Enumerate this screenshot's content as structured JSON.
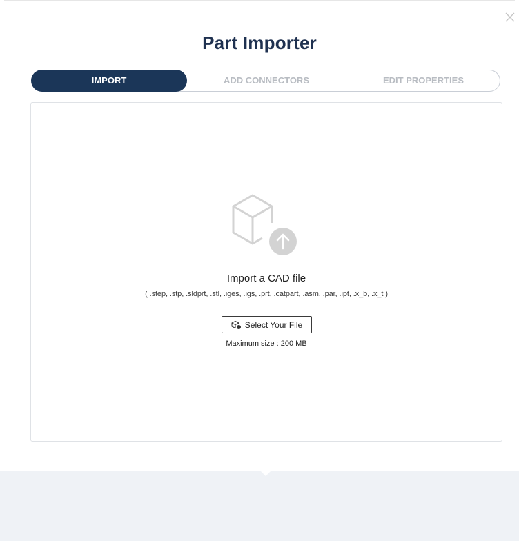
{
  "dialog": {
    "title": "Part Importer",
    "close_icon": "close-icon"
  },
  "steps": [
    {
      "label": "IMPORT",
      "active": true
    },
    {
      "label": "ADD CONNECTORS",
      "active": false
    },
    {
      "label": "EDIT PROPERTIES",
      "active": false
    }
  ],
  "dropzone": {
    "illustration_icon": "cube-upload-icon",
    "heading": "Import a CAD file",
    "formats": "( .step, .stp, .sldprt, .stl, .iges, .igs, .prt, .catpart, .asm, .par, .ipt, .x_b, .x_t )",
    "select_button": {
      "icon": "part-file-icon",
      "label": "Select Your File"
    },
    "max_size": "Maximum size : 200 MB"
  },
  "colors": {
    "title": "#1f3150",
    "active_step_bg": "#1b3658",
    "inactive_step_text": "#b8bcc2",
    "footer_bg": "#eff2f6",
    "illustration": "#d3d3d3"
  }
}
